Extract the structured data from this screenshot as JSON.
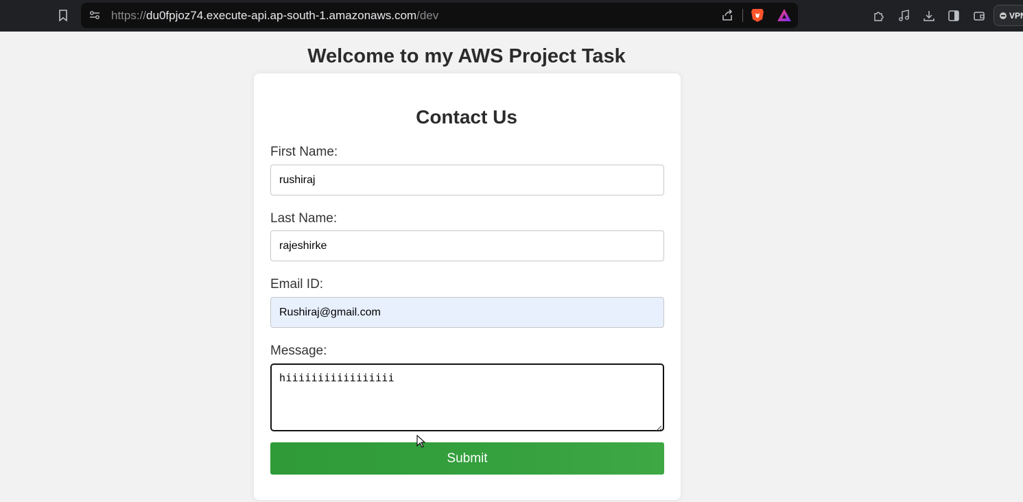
{
  "browser": {
    "url_protocol": "https://",
    "url_host": "du0fpjoz74.execute-api.ap-south-1.amazonaws.com",
    "url_path": "/dev",
    "vpn_label": "VPN",
    "icons": [
      "bookmark-icon",
      "site-settings-icon",
      "share-icon",
      "brave-shield-icon",
      "brave-rewards-icon",
      "extensions-icon",
      "media-icon",
      "download-icon",
      "sidebar-icon",
      "wallet-icon"
    ]
  },
  "page": {
    "title": "Welcome to my AWS Project Task"
  },
  "form": {
    "title": "Contact Us",
    "first_name_label": "First Name:",
    "first_name_value": "rushiraj",
    "last_name_label": "Last Name:",
    "last_name_value": "rajeshirke",
    "email_label": "Email ID:",
    "email_value": "Rushiraj@gmail.com",
    "message_label": "Message:",
    "message_value": "hiiiiiiiiiiiiiiiii",
    "submit_label": "Submit"
  },
  "colors": {
    "toolbar_bg": "#202124",
    "page_bg": "#f2f2f2",
    "submit_green": "#35a03e",
    "autofill_bg": "#e8f0fe"
  }
}
